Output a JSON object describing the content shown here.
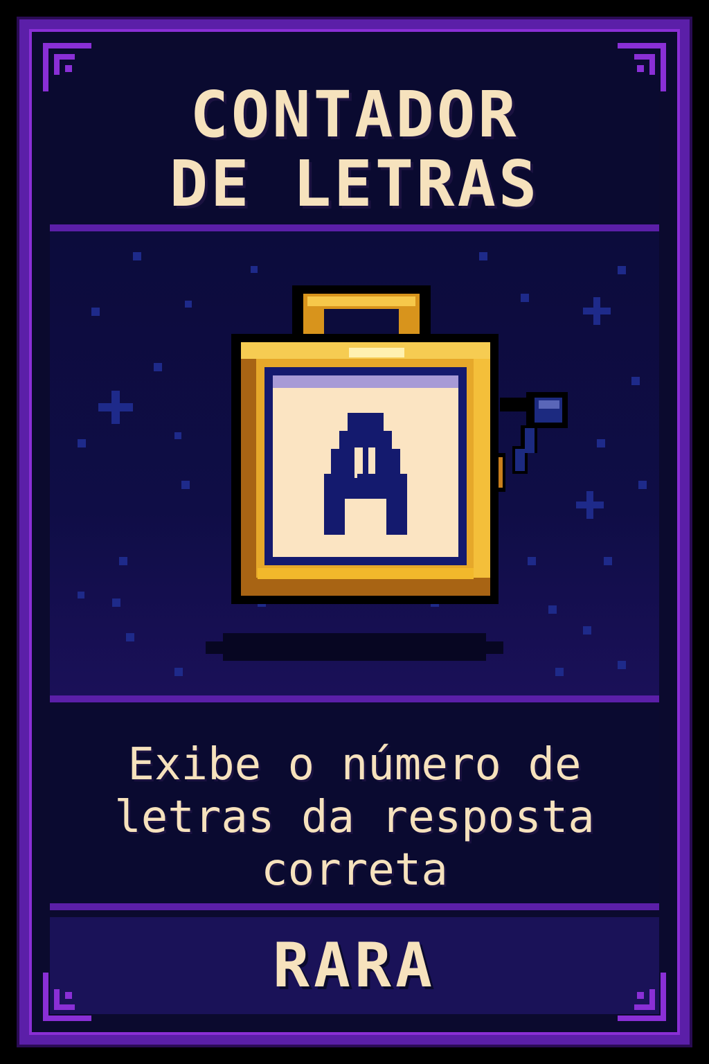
{
  "card": {
    "title": "CONTADOR\nDE LETRAS",
    "description": "Exibe o número de letras da resposta correta",
    "rarity": "RARA",
    "item_letter": "A",
    "item_icon": "letter-counter-device-icon"
  },
  "colors": {
    "frame": "#5b1fa8",
    "frame_light": "#8a2fd6",
    "background": "#0b0a2e",
    "text": "#f6e2bd",
    "gold": "#f2b82b",
    "gold_dark": "#a86414",
    "screen": "#fbe4c2",
    "letter": "#141a6e"
  }
}
